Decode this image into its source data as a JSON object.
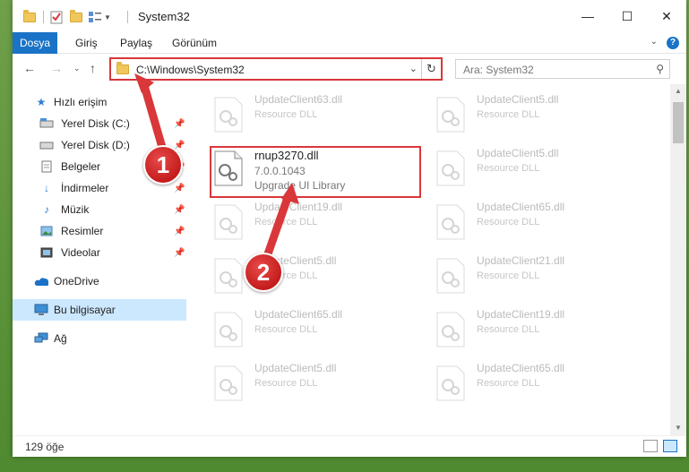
{
  "window": {
    "title": "System32"
  },
  "ribbon": {
    "tabs": [
      "Dosya",
      "Giriş",
      "Paylaş",
      "Görünüm"
    ],
    "help": "?"
  },
  "nav": {
    "address": "C:\\Windows\\System32",
    "search_placeholder": "Ara: System32"
  },
  "sidebar": {
    "items": [
      {
        "label": "Hızlı erişim",
        "icon": "star-icon",
        "pinned": false
      },
      {
        "label": "Yerel Disk (C:)",
        "icon": "drive-icon",
        "pinned": true
      },
      {
        "label": "Yerel Disk (D:)",
        "icon": "drive-icon",
        "pinned": true
      },
      {
        "label": "Belgeler",
        "icon": "documents-icon",
        "pinned": true
      },
      {
        "label": "İndirmeler",
        "icon": "download-icon",
        "pinned": true
      },
      {
        "label": "Müzik",
        "icon": "music-icon",
        "pinned": true
      },
      {
        "label": "Resimler",
        "icon": "pictures-icon",
        "pinned": true
      },
      {
        "label": "Videolar",
        "icon": "videos-icon",
        "pinned": true
      },
      {
        "label": "OneDrive",
        "icon": "cloud-icon",
        "pinned": false
      },
      {
        "label": "Bu bilgisayar",
        "icon": "computer-icon",
        "pinned": false
      },
      {
        "label": "Ağ",
        "icon": "network-icon",
        "pinned": false
      }
    ]
  },
  "files": {
    "left": [
      {
        "name": "UpdateClient63.dll",
        "desc": "Resource DLL"
      },
      {
        "name": "rnup3270.dll",
        "version": "7.0.0.1043",
        "desc": "Upgrade UI Library"
      },
      {
        "name": "UpdateClient19.dll",
        "desc": "Resource DLL"
      },
      {
        "name": "UpdateClient5.dll",
        "desc": "Resource DLL"
      },
      {
        "name": "UpdateClient65.dll",
        "desc": "Resource DLL"
      },
      {
        "name": "UpdateClient5.dll",
        "desc": "Resource DLL"
      }
    ],
    "right": [
      {
        "name": "UpdateClient5.dll",
        "desc": "Resource DLL"
      },
      {
        "name": "UpdateClient5.dll",
        "desc": "Resource DLL"
      },
      {
        "name": "UpdateClient65.dll",
        "desc": "Resource DLL"
      },
      {
        "name": "UpdateClient21.dll",
        "desc": "Resource DLL"
      },
      {
        "name": "UpdateClient19.dll",
        "desc": "Resource DLL"
      },
      {
        "name": "UpdateClient65.dll",
        "desc": "Resource DLL"
      }
    ]
  },
  "status": {
    "count": "129 öğe"
  },
  "annotations": {
    "step1": "1",
    "step2": "2",
    "color": "#d9373a"
  }
}
